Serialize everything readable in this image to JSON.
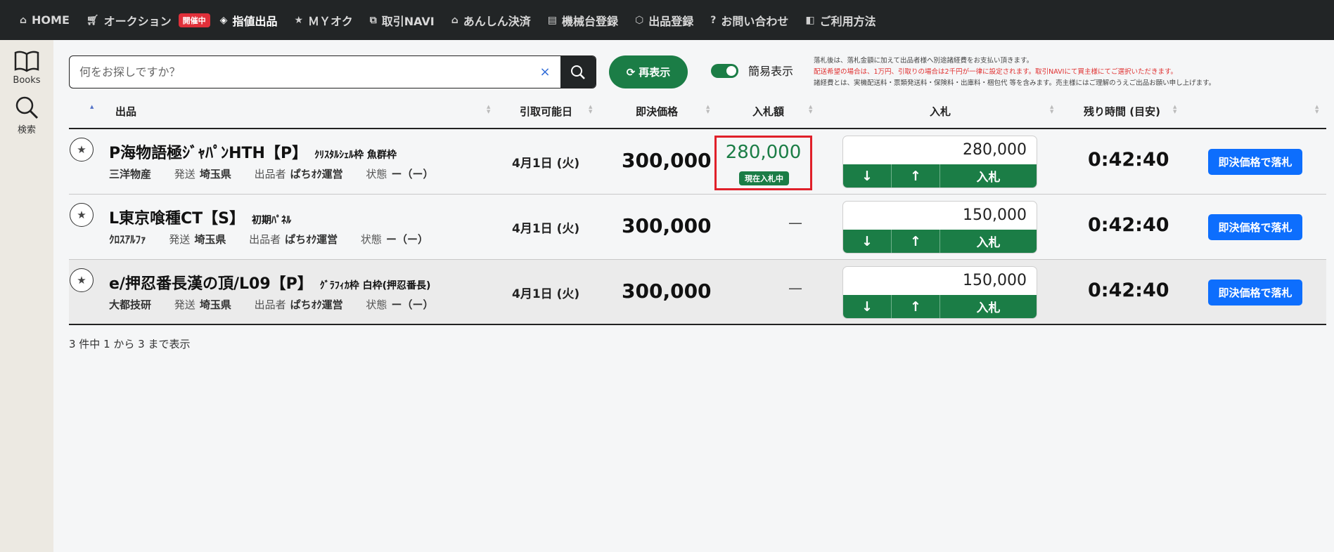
{
  "nav": {
    "home": "HOME",
    "auction": "オークション",
    "auction_badge": "開催中",
    "sashine": "指値出品",
    "my": "ＭＹオク",
    "navi": "取引NAVI",
    "anshin": "あんしん決済",
    "machine": "機械台登録",
    "listing": "出品登録",
    "contact": "お問い合わせ",
    "howto": "ご利用方法"
  },
  "sidebar": {
    "books": "Books",
    "search": "検索"
  },
  "search": {
    "placeholder": "何をお探しですか？",
    "clear": "×"
  },
  "refresh_label": "再表示",
  "toggle_label": "簡易表示",
  "notes": [
    "落札後は、落札金額に加えて出品者様へ別途諸経費をお支払い頂きます。",
    "配送希望の場合は、1万円、引取りの場合は2千円が一律に設定されます。取引NAVIにて買主様にてご選択いただきます。",
    "諸経費とは、実機配送料・票類発送料・保険料・出庫料・梱包代 等を含みます。売主様にはご理解のうえご出品お願い申し上げます。"
  ],
  "table": {
    "headers": {
      "item": "出品",
      "date": "引取可能日",
      "buynow": "即決価格",
      "bidamount": "入札額",
      "bid": "入札",
      "remaining": "残り時間 (目安)"
    },
    "labels": {
      "ship": "発送",
      "seller": "出品者",
      "status": "状態"
    },
    "rows": [
      {
        "title": "P海物語極ｼﾞｬﾊﾟﾝHTH【P】",
        "subtitle": "ｸﾘｽﾀﾙｼｪﾙ枠 魚群枠",
        "maker": "三洋物産",
        "ship": "埼玉県",
        "seller": "ぱちｵｸ運営",
        "status": "ー（ー）",
        "date": "4月1日 (火)",
        "price": "300,000",
        "current_bid": "280,000",
        "current_badge": "現在入札中",
        "bid_input": "280,000",
        "bid_down": "↓",
        "bid_up": "↑",
        "bid_label": "入札",
        "remaining": "0:42:40",
        "buynow_label": "即決価格で落札"
      },
      {
        "title": "L東京喰種CT【S】",
        "subtitle": "初期ﾊﾟﾈﾙ",
        "maker": "ｸﾛｽｱﾙﾌｧ",
        "ship": "埼玉県",
        "seller": "ぱちｵｸ運営",
        "status": "ー（ー）",
        "date": "4月1日 (火)",
        "price": "300,000",
        "current_bid": "—",
        "bid_input": "150,000",
        "bid_down": "↓",
        "bid_up": "↑",
        "bid_label": "入札",
        "remaining": "0:42:40",
        "buynow_label": "即決価格で落札"
      },
      {
        "title": "e/押忍番長漢の頂/L09【P】",
        "subtitle": "ｸﾞﾗﾌｨｶ枠 白枠(押忍番長)",
        "maker": "大都技研",
        "ship": "埼玉県",
        "seller": "ぱちｵｸ運営",
        "status": "ー（ー）",
        "date": "4月1日 (火)",
        "price": "300,000",
        "current_bid": "—",
        "bid_input": "150,000",
        "bid_down": "↓",
        "bid_up": "↑",
        "bid_label": "入札",
        "remaining": "0:42:40",
        "buynow_label": "即決価格で落札"
      }
    ]
  },
  "footer": "3 件中 1 から 3 まで表示",
  "colors": {
    "nav_bg": "#222526",
    "green": "#1b7d46",
    "blue": "#0d6efd",
    "red": "#e0202a",
    "sidebar_bg": "#ece9e2"
  }
}
